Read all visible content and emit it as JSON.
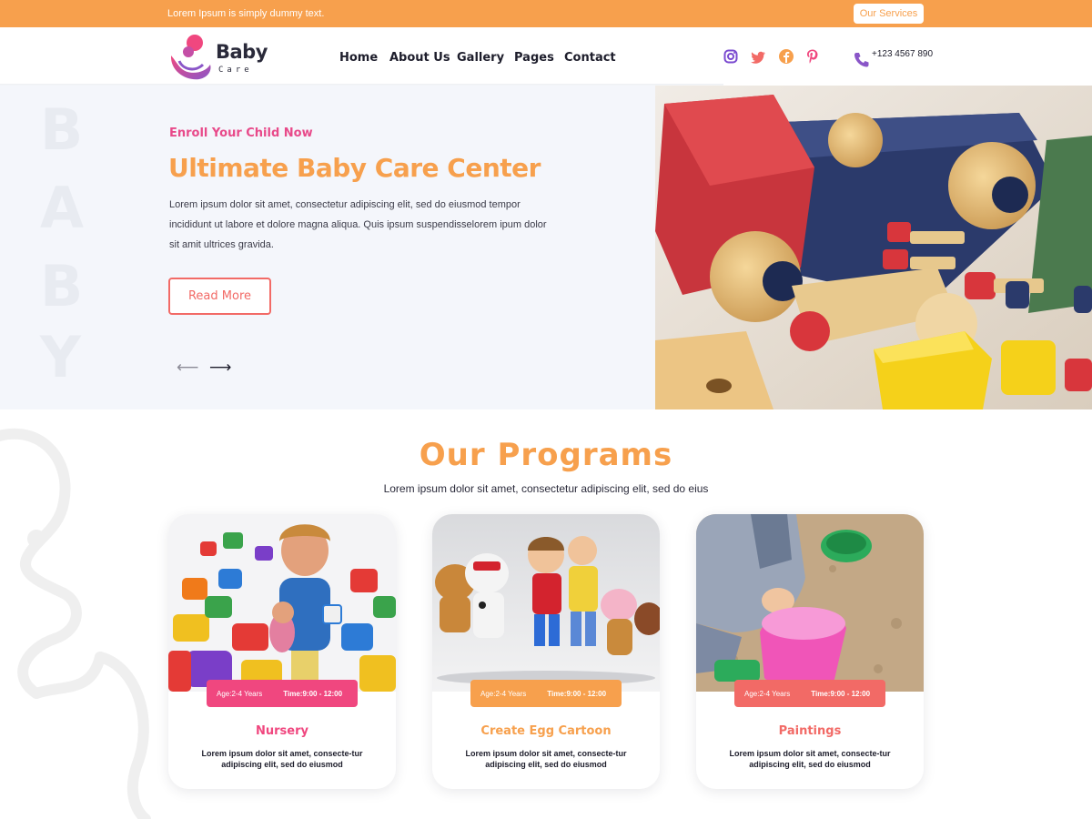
{
  "topbar": {
    "tagline": "Lorem Ipsum is simply dummy text.",
    "services_label": "Our Services"
  },
  "logo": {
    "word": "Baby",
    "sub": "Care"
  },
  "nav": {
    "items": [
      "Home",
      "About Us",
      "Gallery",
      "Pages",
      "Contact"
    ]
  },
  "social": {
    "icons": [
      "instagram-icon",
      "twitter-icon",
      "facebook-icon",
      "pinterest-icon"
    ]
  },
  "contact": {
    "phone": "+123 4567 890"
  },
  "hero": {
    "ghost_letters": [
      "B",
      "A",
      "B",
      "Y"
    ],
    "eyebrow": "Enroll Your Child Now",
    "title": "Ultimate Baby Care Center",
    "text": "Lorem ipsum dolor sit amet, consectetur adipiscing elit, sed do eiusmod tempor incididunt ut labore et dolore magna aliqua. Quis ipsum suspendisselorem ipum dolor sit amit  ultrices gravida.",
    "button": "Read More",
    "prev": "⟵",
    "next": "⟶"
  },
  "programs": {
    "title": "Our Programs",
    "subtitle": "Lorem ipsum dolor sit amet, consectetur adipiscing elit, sed do eius",
    "cards": [
      {
        "name": "Nursery",
        "age": "Age:2-4 Years",
        "time": "Time:9:00 - 12:00",
        "desc": "Lorem ipsum dolor sit amet, consecte-tur adipiscing elit, sed do eiusmod",
        "color": "#f0477f"
      },
      {
        "name": "Create Egg Cartoon",
        "age": "Age:2-4 Years",
        "time": "Time:9:00 - 12:00",
        "desc": "Lorem ipsum dolor sit amet, consecte-tur adipiscing elit, sed do eiusmod",
        "color": "#f7a04d"
      },
      {
        "name": "Paintings",
        "age": "Age:2-4 Years",
        "time": "Time:9:00 - 12:00",
        "desc": "Lorem ipsum dolor sit amet, consecte-tur adipiscing elit, sed do eiusmod",
        "color": "#f26a66"
      }
    ]
  },
  "colors": {
    "orange": "#f7a04d",
    "pink": "#f0477f",
    "coral": "#f26a66",
    "hero_bg": "#f4f6fb"
  }
}
